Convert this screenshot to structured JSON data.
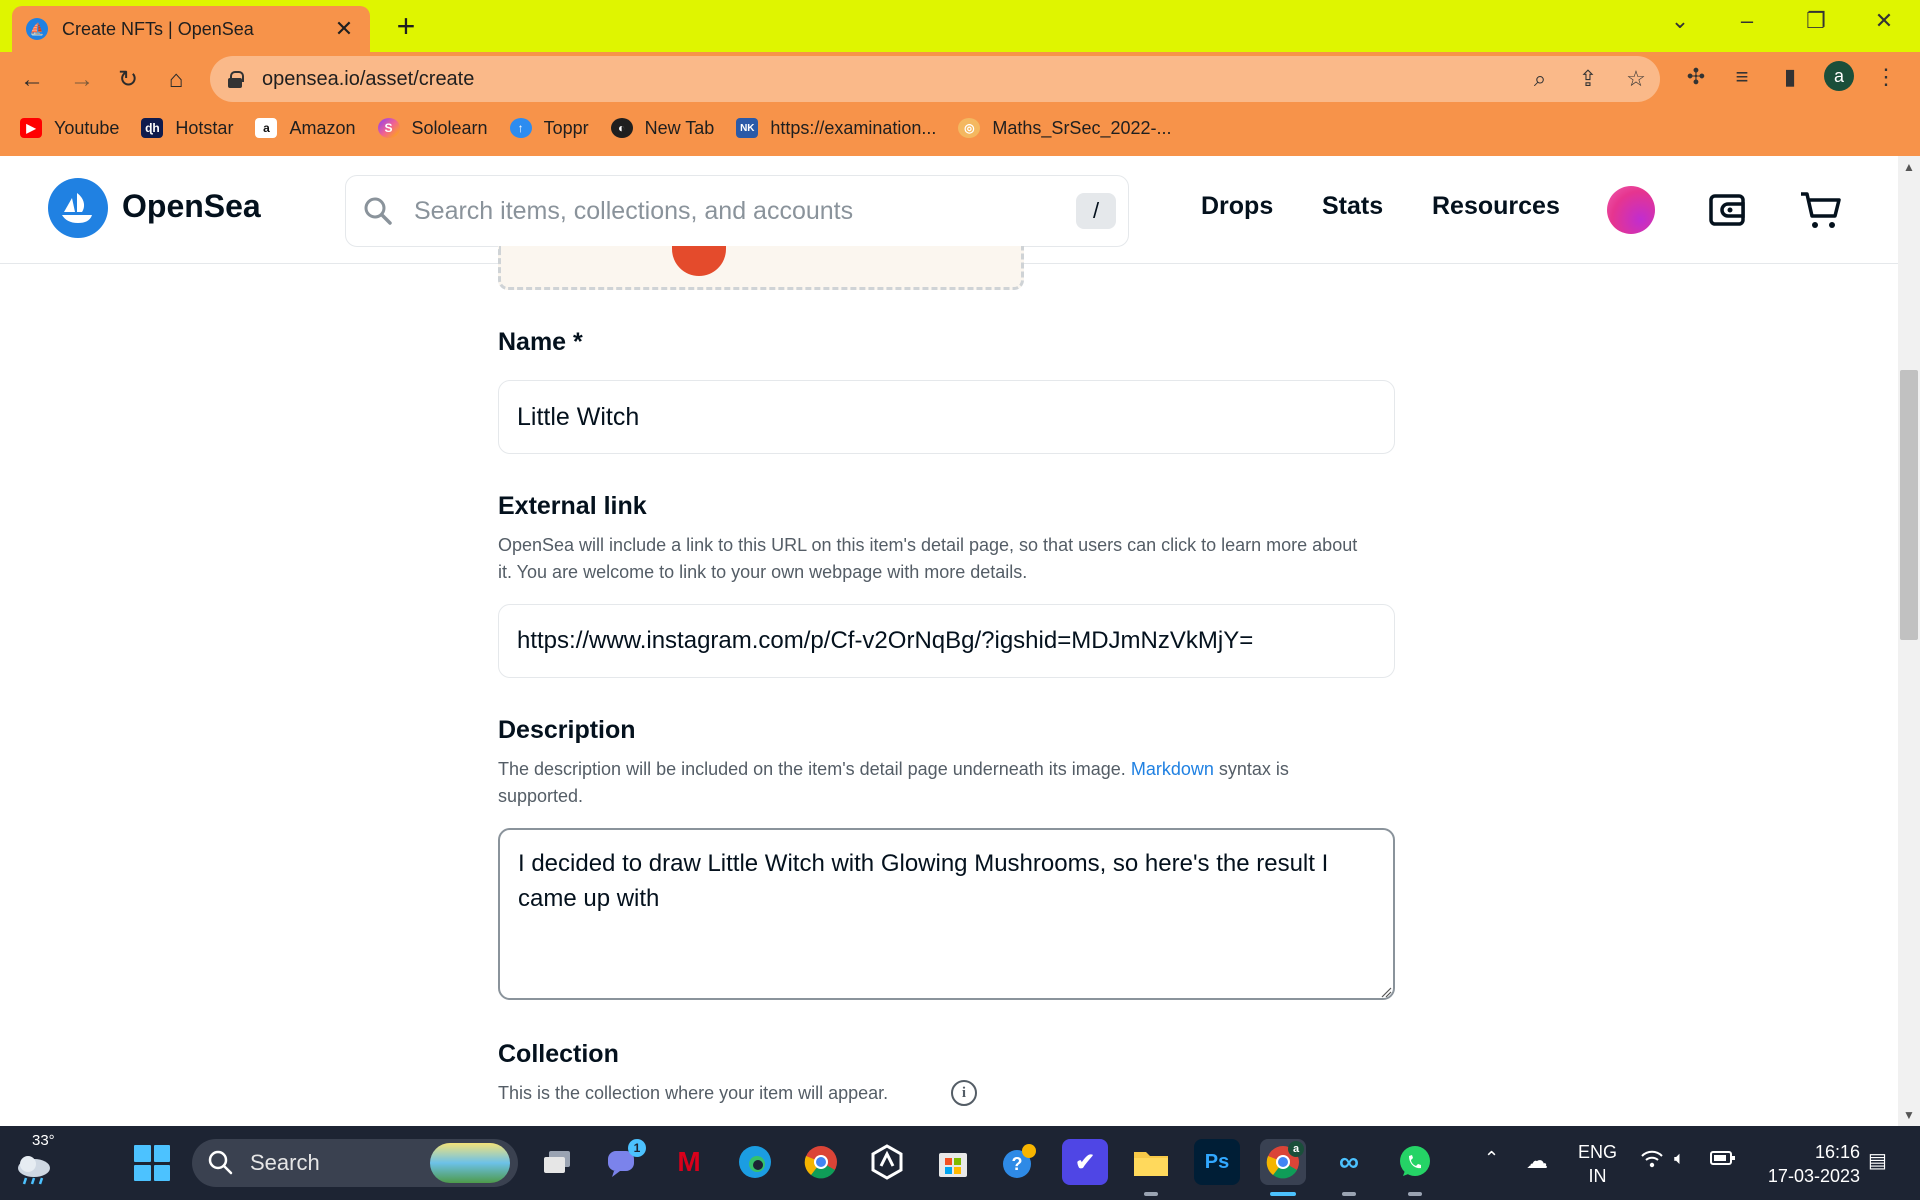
{
  "browser": {
    "tab_title": "Create NFTs | OpenSea",
    "url": "opensea.io/asset/create",
    "profile_initial": "a",
    "bookmarks": [
      {
        "label": "Youtube",
        "color": "#ff0000",
        "glyph": "▶"
      },
      {
        "label": "Hotstar",
        "color": "#0f1b4d",
        "glyph": "ɖh"
      },
      {
        "label": "Amazon",
        "color": "#ffffff",
        "glyph": "a"
      },
      {
        "label": "Sololearn",
        "color": "#8b3df5",
        "glyph": "S"
      },
      {
        "label": "Toppr",
        "color": "#2d8cf0",
        "glyph": "↑"
      },
      {
        "label": "New Tab",
        "color": "#1f1f1f",
        "glyph": "◐"
      },
      {
        "label": "https://examination...",
        "color": "#2b5aa8",
        "glyph": "NK"
      },
      {
        "label": "Maths_SrSec_2022-...",
        "color": "#f4b860",
        "glyph": "◎"
      }
    ]
  },
  "opensea": {
    "brand": "OpenSea",
    "search_placeholder": "Search items, collections, and accounts",
    "search_shortcut": "/",
    "nav": [
      "Drops",
      "Stats",
      "Resources"
    ],
    "brand_color": "#2081e2"
  },
  "form": {
    "name_label": "Name *",
    "name_value": "Little Witch",
    "external_label": "External link",
    "external_hint": "OpenSea will include a link to this URL on this item's detail page, so that users can click to learn more about it. You are welcome to link to your own webpage with more details.",
    "external_value": "https://www.instagram.com/p/Cf-v2OrNqBg/?igshid=MDJmNzVkMjY=",
    "description_label": "Description",
    "description_hint_pre": "The description will be included on the item's detail page underneath its image.",
    "description_hint_link": "Markdown",
    "description_hint_post": "syntax is supported.",
    "description_value": "I decided to draw Little Witch with Glowing Mushrooms, so here's the result I came up with",
    "collection_label": "Collection",
    "collection_hint": "This is the collection where your item will appear."
  },
  "taskbar": {
    "weather_temp": "33°",
    "search_label": "Search",
    "chat_badge": "1",
    "chrome_badge": "a",
    "lang_line1": "ENG",
    "lang_line2": "IN",
    "time": "16:16",
    "date": "17-03-2023"
  }
}
